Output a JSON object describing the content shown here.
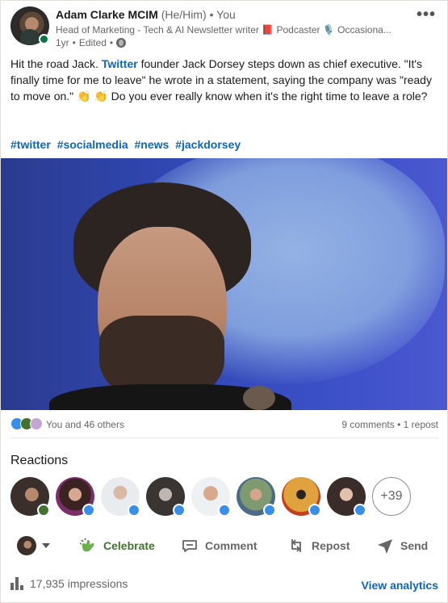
{
  "author": {
    "name": "Adam Clarke MCIM",
    "pronouns": "(He/Him)",
    "degree": "You",
    "headline": "Head of Marketing - Tech & AI Newsletter writer 📕 Podcaster 🎙️ Occasiona...",
    "age": "1yr",
    "edited": "Edited"
  },
  "post": {
    "text_before_link": "Hit the road Jack. ",
    "link_text": "Twitter",
    "text_after_link": " founder Jack Dorsey steps down as chief executive. \"It's finally time for me to leave\" he wrote in a statement, saying the company was \"ready to move on.\" 👏 👏 Do you ever really know when it's the right time to leave a role?",
    "hashtags": [
      "#twitter",
      "#socialmedia",
      "#news",
      "#jackdorsey"
    ]
  },
  "social_counts": {
    "reactions": "You and 46 others",
    "comments": "9 comments",
    "separator": "•",
    "reposts": "1 repost"
  },
  "reactions_section": {
    "title": "Reactions",
    "more": "+39"
  },
  "actions": {
    "celebrate": "Celebrate",
    "comment": "Comment",
    "repost": "Repost",
    "send": "Send"
  },
  "footer": {
    "impressions": "17,935 impressions",
    "view_analytics": "View analytics"
  },
  "colors": {
    "link": "#0a66c2",
    "celebrate": "#44712e",
    "like": "#378fe9"
  }
}
